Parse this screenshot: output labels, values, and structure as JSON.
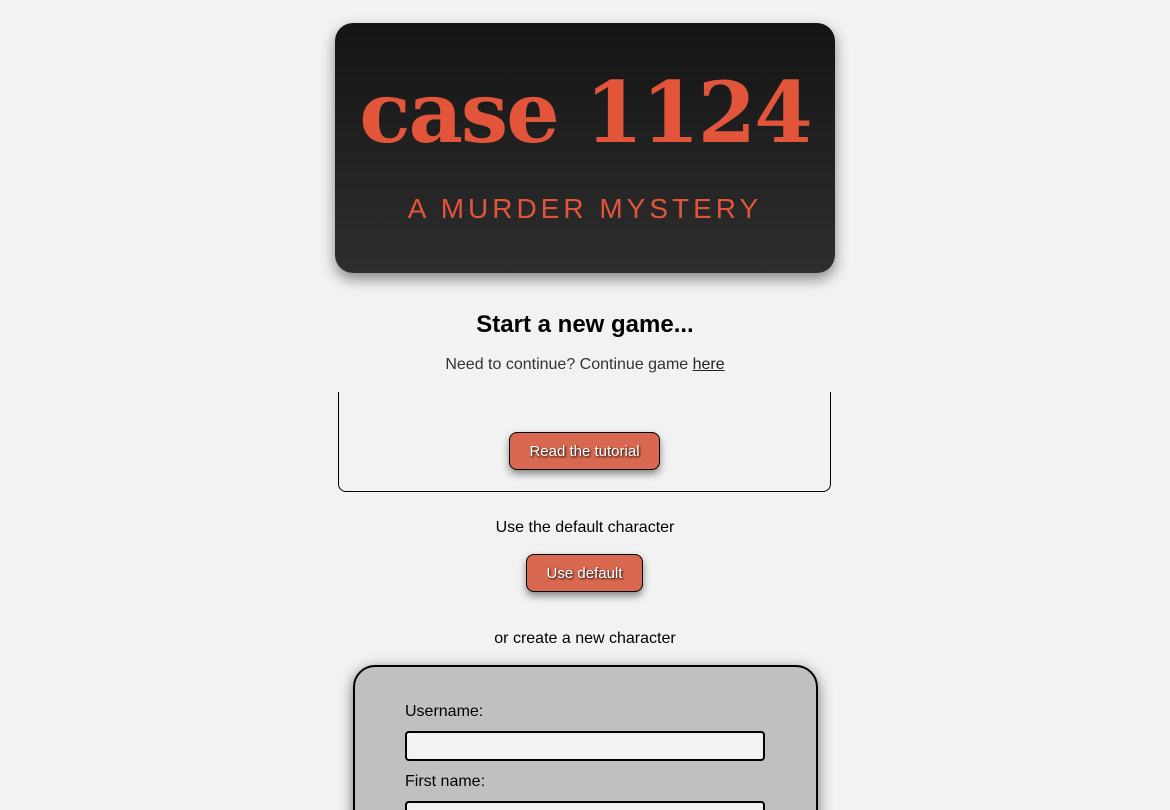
{
  "banner": {
    "title": "case 1124",
    "subtitle": "A MURDER MYSTERY"
  },
  "main": {
    "heading": "Start a new game...",
    "continue_text": "Need to continue? Continue game ",
    "continue_link": "here"
  },
  "tutorial": {
    "button_label": "Read the tutorial"
  },
  "default_character": {
    "label": "Use the default character",
    "button_label": "Use default"
  },
  "create_character": {
    "label": "or create a new character",
    "fields": [
      {
        "label": "Username:",
        "value": ""
      },
      {
        "label": "First name:",
        "value": ""
      }
    ]
  },
  "colors": {
    "accent": "#e2553a",
    "button": "#d8684f",
    "background": "#f2f2f2",
    "form_panel": "#c0c0c0"
  }
}
